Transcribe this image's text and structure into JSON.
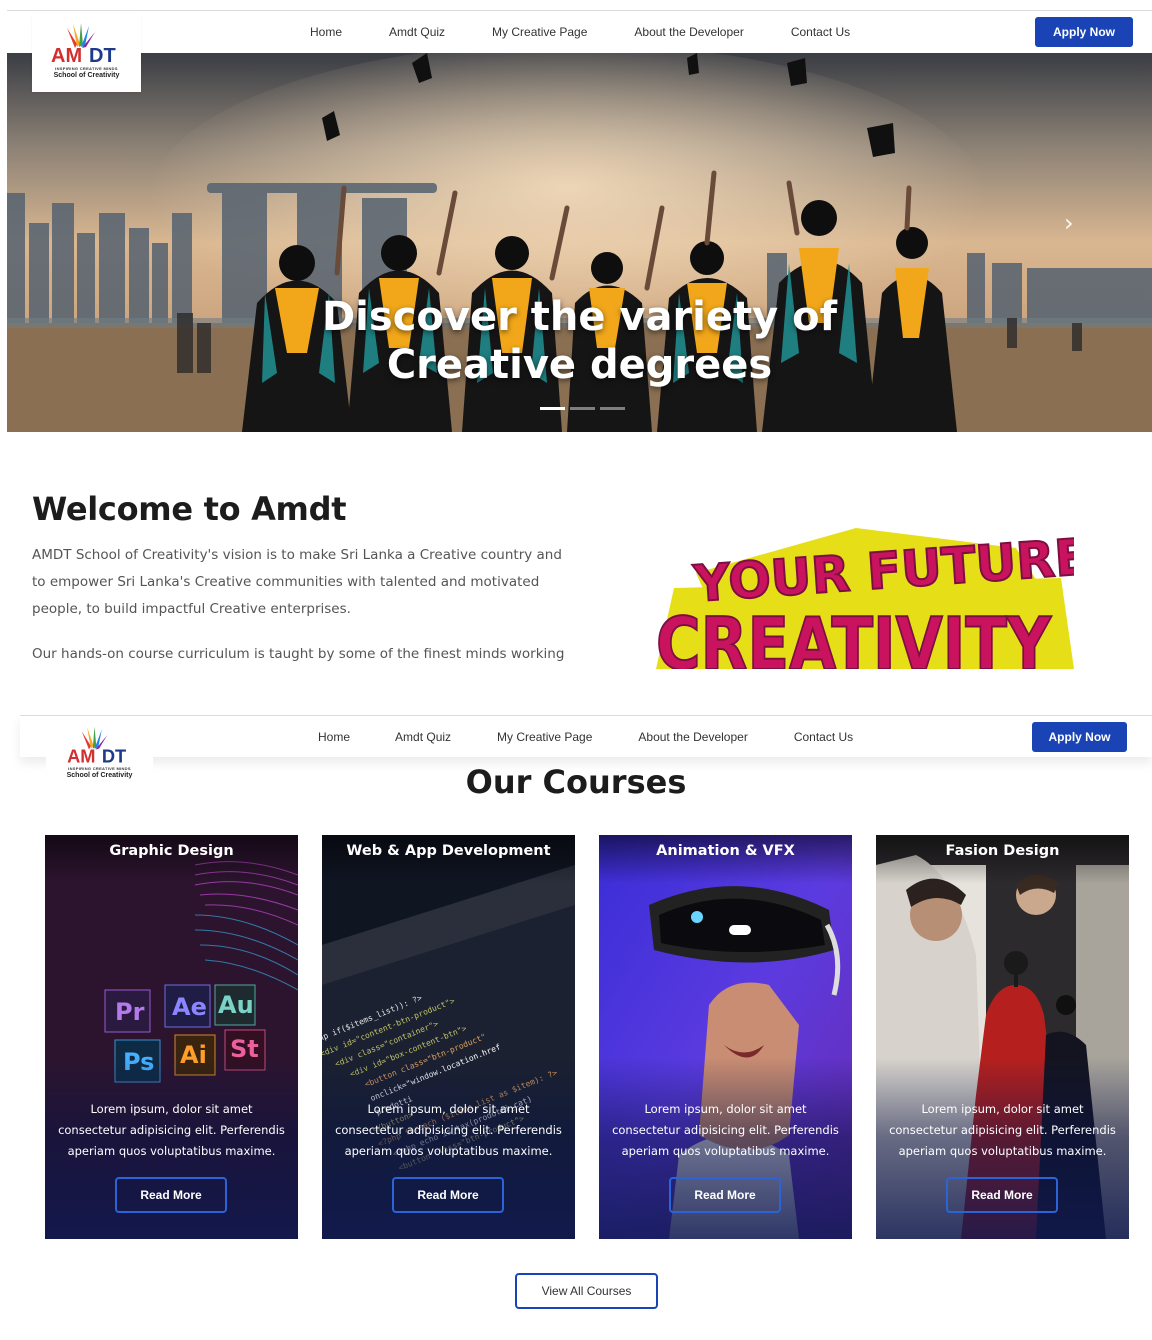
{
  "brand": {
    "logo_text": "AMDT",
    "logo_tagline": "INSPIRING CREATIVE MINDS",
    "logo_school": "School of Creativity"
  },
  "nav": {
    "items": [
      {
        "label": "Home"
      },
      {
        "label": "Amdt Quiz"
      },
      {
        "label": "My Creative Page"
      },
      {
        "label": "About the Developer"
      },
      {
        "label": "Contact Us"
      }
    ],
    "apply_label": "Apply Now"
  },
  "hero": {
    "title": "Discover the variety of Creative degrees",
    "slide_count": 3,
    "active_slide": 1,
    "next_icon": "chevron-right-icon"
  },
  "welcome": {
    "heading": "Welcome to Amdt",
    "paragraph1": "AMDT School of Creativity's vision is to make Sri Lanka a Creative country and to empower Sri Lanka's Creative communities with talented and motivated people, to build impactful Creative enterprises.",
    "paragraph2": "Our hands-on course curriculum is taught by some of the finest minds working in",
    "art_text_line1": "YOUR FUTURE TO",
    "art_text_line2": "CREATIVITY"
  },
  "courses": {
    "heading": "Our Courses",
    "items": [
      {
        "title": "Graphic Design",
        "description": "Lorem ipsum, dolor sit amet consectetur adipisicing elit. Perferendis aperiam quos voluptatibus maxime.",
        "button": "Read More"
      },
      {
        "title": "Web & App Development",
        "description": "Lorem ipsum, dolor sit amet consectetur adipisicing elit. Perferendis aperiam quos voluptatibus maxime.",
        "button": "Read More"
      },
      {
        "title": "Animation & VFX",
        "description": "Lorem ipsum, dolor sit amet consectetur adipisicing elit. Perferendis aperiam quos voluptatibus maxime.",
        "button": "Read More"
      },
      {
        "title": "Fasion Design",
        "description": "Lorem ipsum, dolor sit amet consectetur adipisicing elit. Perferendis aperiam quos voluptatibus maxime.",
        "button": "Read More"
      }
    ],
    "view_all_label": "View All Courses"
  },
  "colors": {
    "primary_button": "#1a44b6",
    "card_border_button": "#2c63d6",
    "heading": "#1c1c1c"
  }
}
